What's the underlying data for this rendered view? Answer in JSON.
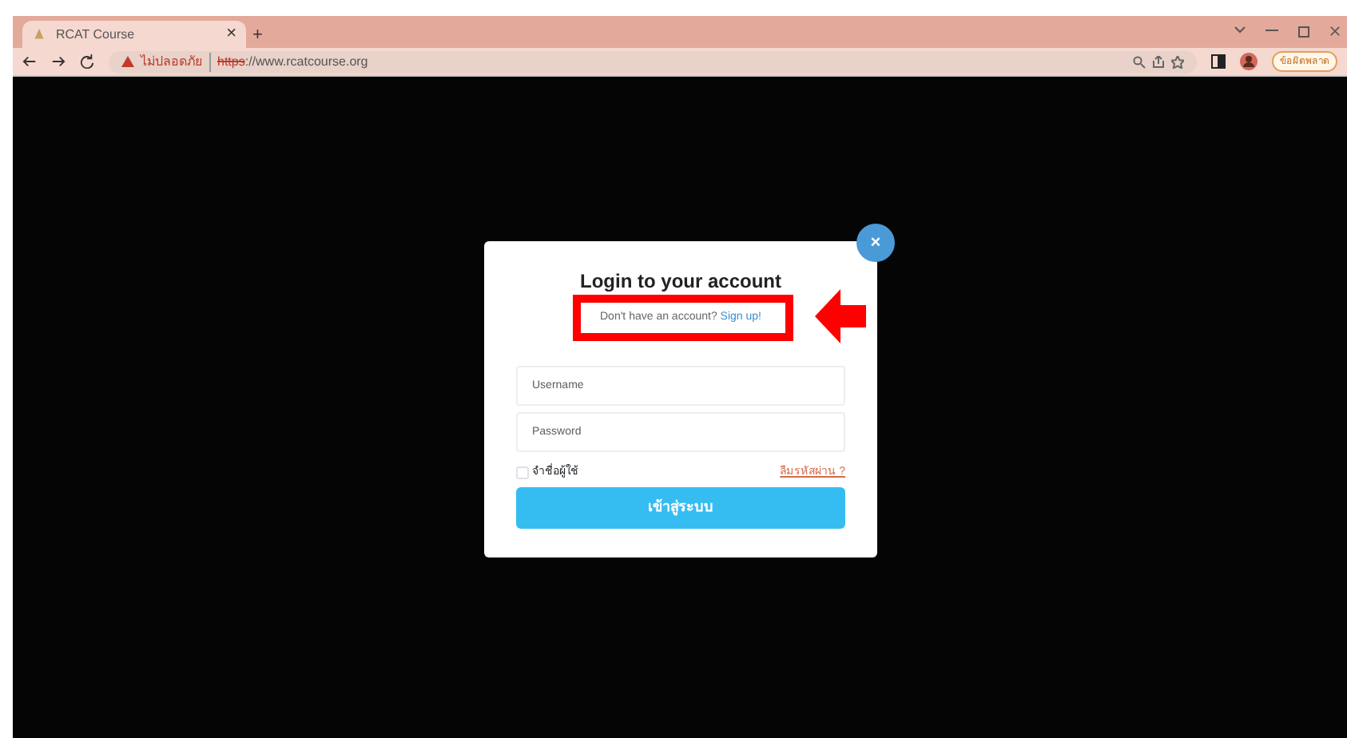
{
  "browser": {
    "tab": {
      "title": "RCAT Course",
      "close": "×"
    },
    "new_tab": "+",
    "security": "ไม่ปลอดภัย",
    "url_scheme": "https",
    "url_rest": "://www.rcatcourse.org",
    "error_chip": "ข้อผิดพลาด"
  },
  "modal": {
    "close": "×",
    "title": "Login to your account",
    "signup_prompt": "Don't have an account?",
    "signup_link": "Sign up!",
    "fields": [
      {
        "placeholder": "Username"
      },
      {
        "placeholder": "Password"
      }
    ],
    "remember": {
      "label": "จำชื่อผู้ใช้",
      "checked": false
    },
    "forgot": "ลืมรหัสผ่าน ?",
    "submit": "เข้าสู่ระบบ"
  }
}
